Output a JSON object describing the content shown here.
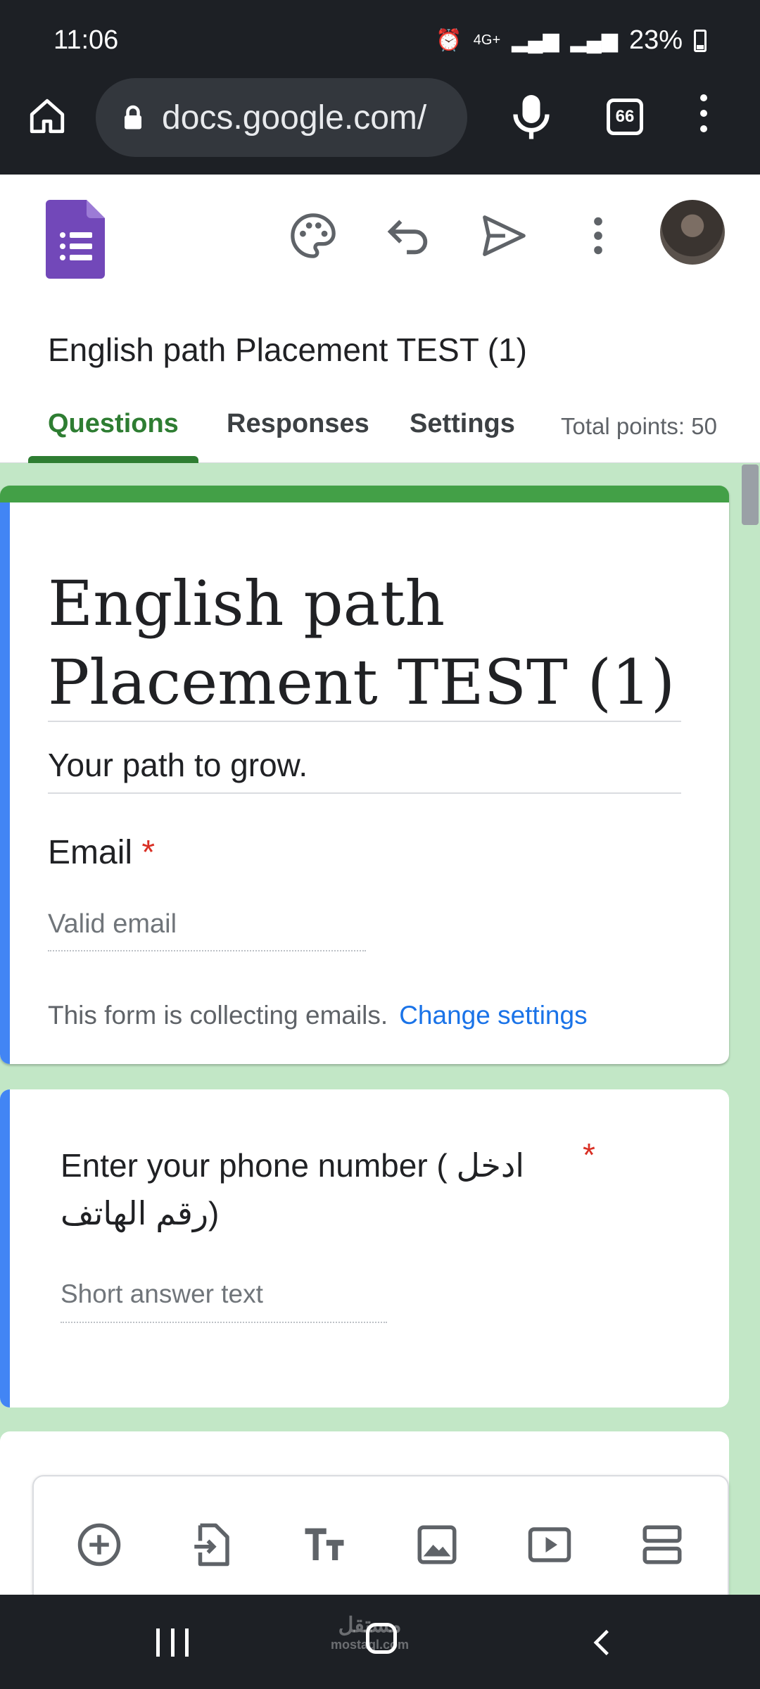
{
  "status_bar": {
    "time": "11:06",
    "network": "4G+",
    "battery": "23%"
  },
  "browser": {
    "url": "docs.google.com/",
    "tab_count": "66"
  },
  "header": {
    "doc_title": "English path Placement TEST (1)",
    "tabs": [
      {
        "label": "Questions",
        "active": true
      },
      {
        "label": "Responses",
        "active": false
      },
      {
        "label": "Settings",
        "active": false
      }
    ],
    "total_points": "Total points: 50"
  },
  "form": {
    "title": "English path Placement TEST (1)",
    "description": "Your path to grow.",
    "email_label": "Email",
    "required_mark": "*",
    "email_placeholder": "Valid email",
    "collecting_note": "This form is collecting emails.",
    "change_settings": "Change settings"
  },
  "question": {
    "text": "Enter your phone number ( ادخل رقم الهاتف)",
    "required_mark": "*",
    "placeholder": "Short answer text"
  },
  "toolbar": {
    "items": [
      "add-question",
      "import-questions",
      "add-title",
      "add-image",
      "add-video",
      "add-section"
    ]
  },
  "watermark": {
    "text": "مستقل",
    "sub": "mostaql.com"
  },
  "colors": {
    "theme_green": "#43a047",
    "accent_blue": "#4285f4",
    "bg_green": "#c2e7c6",
    "link_blue": "#1a73e8",
    "required_red": "#d93025"
  }
}
